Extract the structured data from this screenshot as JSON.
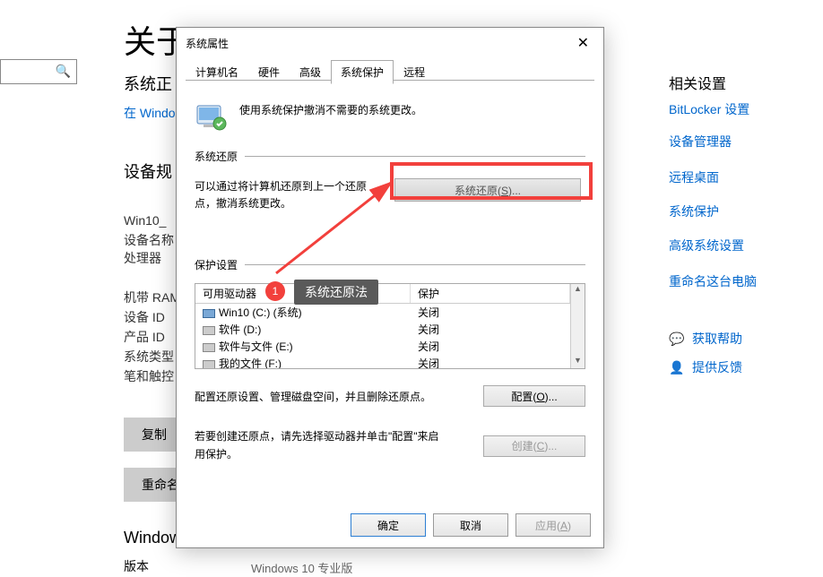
{
  "bg": {
    "title": "关于",
    "status": "系统正",
    "link": "在 Windo",
    "device_title": "设备规",
    "specs": [
      "Win10_",
      "设备名称",
      "处理器",
      "机带 RAM",
      "设备 ID",
      "产品 ID",
      "系统类型",
      "笔和触控"
    ],
    "copy_btn": "复制",
    "rename_btn": "重命名",
    "win_section": "Windows",
    "version_label": "版本",
    "version_value": "Windows 10 专业版"
  },
  "sidebar_right": {
    "title": "相关设置",
    "links": [
      "BitLocker 设置",
      "设备管理器",
      "远程桌面",
      "系统保护",
      "高级系统设置",
      "重命名这台电脑"
    ],
    "actions": [
      {
        "icon": "💬",
        "label": "获取帮助"
      },
      {
        "icon": "👤",
        "label": "提供反馈"
      }
    ]
  },
  "dialog": {
    "title": "系统属性",
    "tabs": [
      "计算机名",
      "硬件",
      "高级",
      "系统保护",
      "远程"
    ],
    "active_tab": 3,
    "message": "使用系统保护撤消不需要的系统更改。",
    "restore_section": "系统还原",
    "restore_text": "可以通过将计算机还原到上一个还原点，撤消系统更改。",
    "restore_btn": "系统还原(S)...",
    "protect_section": "保护设置",
    "columns": {
      "drive": "可用驱动器",
      "protect": "保护"
    },
    "drives": [
      {
        "name": "Win10 (C:) (系统)",
        "protect": "关闭",
        "type": "sys"
      },
      {
        "name": "软件 (D:)",
        "protect": "关闭",
        "type": "hdd"
      },
      {
        "name": "软件与文件 (E:)",
        "protect": "关闭",
        "type": "hdd"
      },
      {
        "name": "我的文件 (F:)",
        "protect": "关闭",
        "type": "hdd"
      }
    ],
    "config_text": "配置还原设置、管理磁盘空间，并且删除还原点。",
    "config_btn": "配置(O)...",
    "create_text": "若要创建还原点，请先选择驱动器并单击\"配置\"来启用保护。",
    "create_btn": "创建(C)...",
    "ok": "确定",
    "cancel": "取消",
    "apply": "应用(A)"
  },
  "annotation": {
    "badge": "1",
    "tooltip": "系统还原法"
  }
}
